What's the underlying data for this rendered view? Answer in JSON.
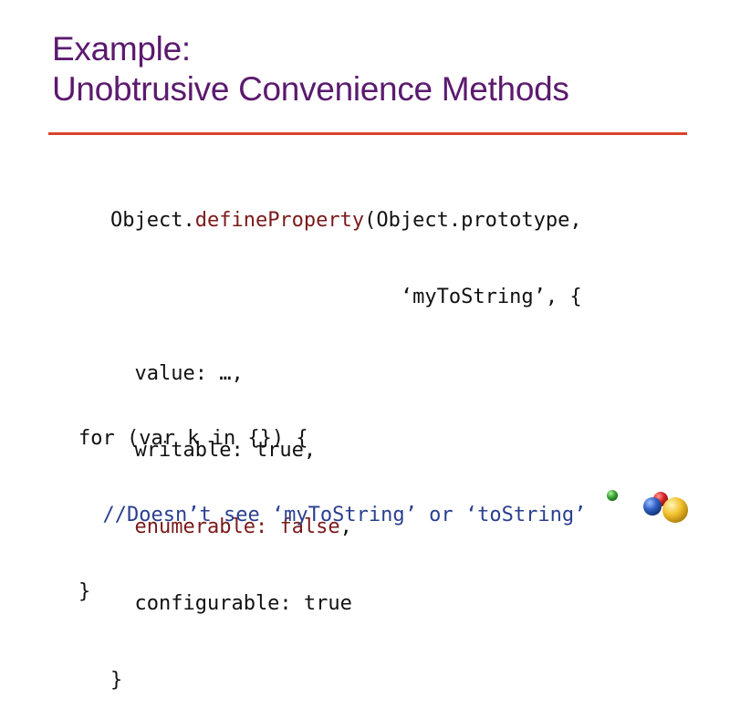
{
  "slide": {
    "title_line1": "Example:",
    "title_line2": "Unobtrusive Convenience Methods"
  },
  "code_block_1": {
    "line1_a": "Object.",
    "line1_b": "defineProperty",
    "line1_c": "(Object.prototype,",
    "line2": "                        ‘myToString’, {",
    "line3": "  value: …,",
    "line4": "  writable: true,",
    "line5_prefix": "  ",
    "line5": "enumerable: false",
    "line5_suffix": ",",
    "line6": "  configurable: true",
    "line7": "}"
  },
  "code_block_2": {
    "line1": "for (var k in {}) {",
    "line2_prefix": "  ",
    "line2": "//Doesn’t see ‘myToString’ or ‘toString’",
    "line3": "}"
  },
  "colors": {
    "title": "#5b1a6e",
    "rule": "#d9432b",
    "highlight": "#7a1a1a",
    "comment": "#2a3f8f",
    "logo_balls": [
      "#3aa835",
      "#d8232a",
      "#2f5fc4",
      "#f2c12e"
    ]
  },
  "logo": {
    "icon": "google-balls-logo-icon"
  }
}
